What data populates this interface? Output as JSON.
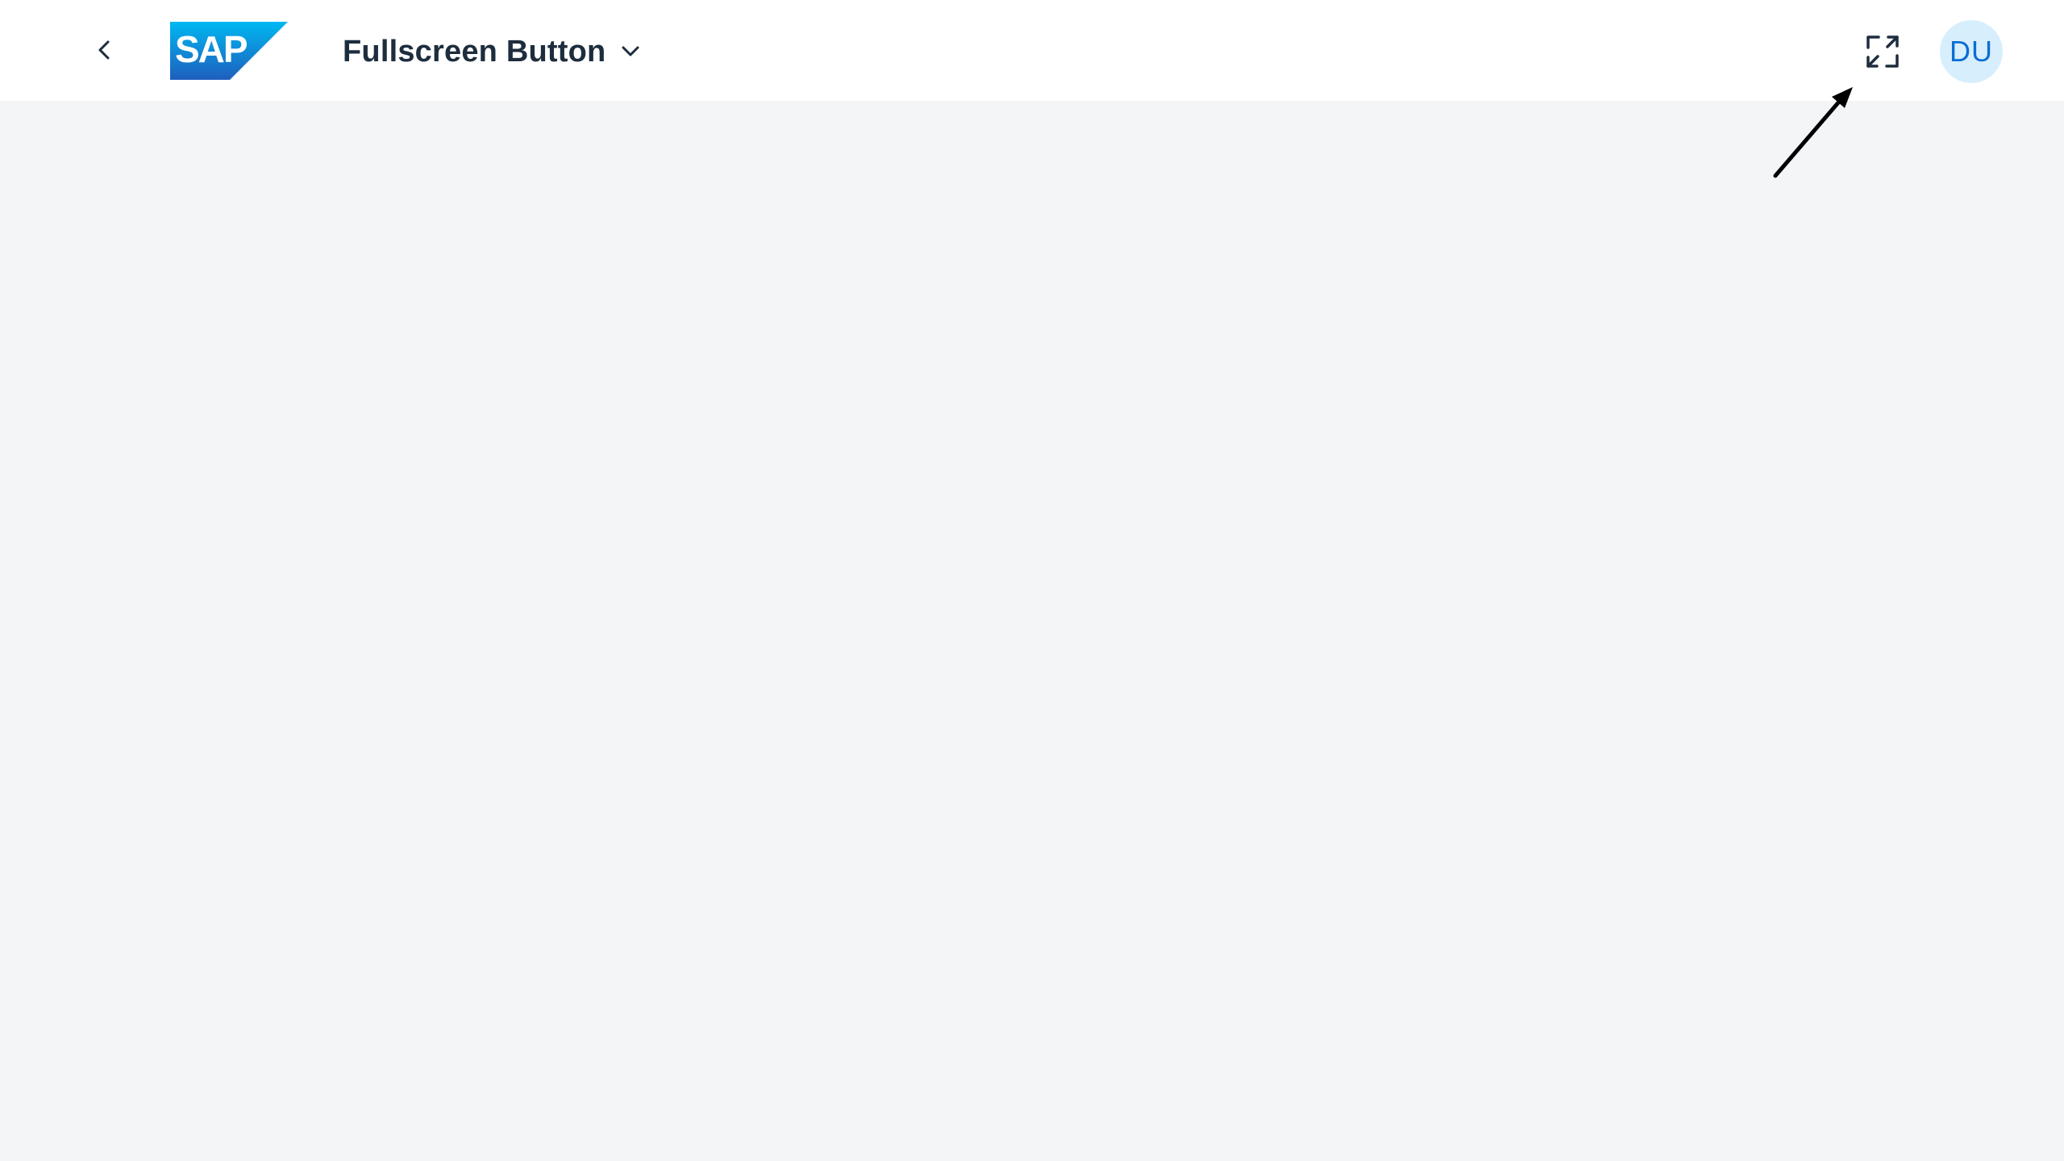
{
  "shellbar": {
    "back_icon": "chevron-left-icon",
    "logo_text": "SAP",
    "title": "Fullscreen Button",
    "title_icon": "chevron-down-icon",
    "fullscreen_icon": "fullscreen-icon",
    "avatar_initials": "DU"
  },
  "colors": {
    "shell_background": "#ffffff",
    "page_background": "#f4f5f7",
    "title_text": "#1d2d3e",
    "avatar_background": "#d7eefd",
    "avatar_text": "#0a6ed1",
    "logo_gradient_start": "#00b8f1",
    "logo_gradient_end": "#1e5fbd"
  }
}
